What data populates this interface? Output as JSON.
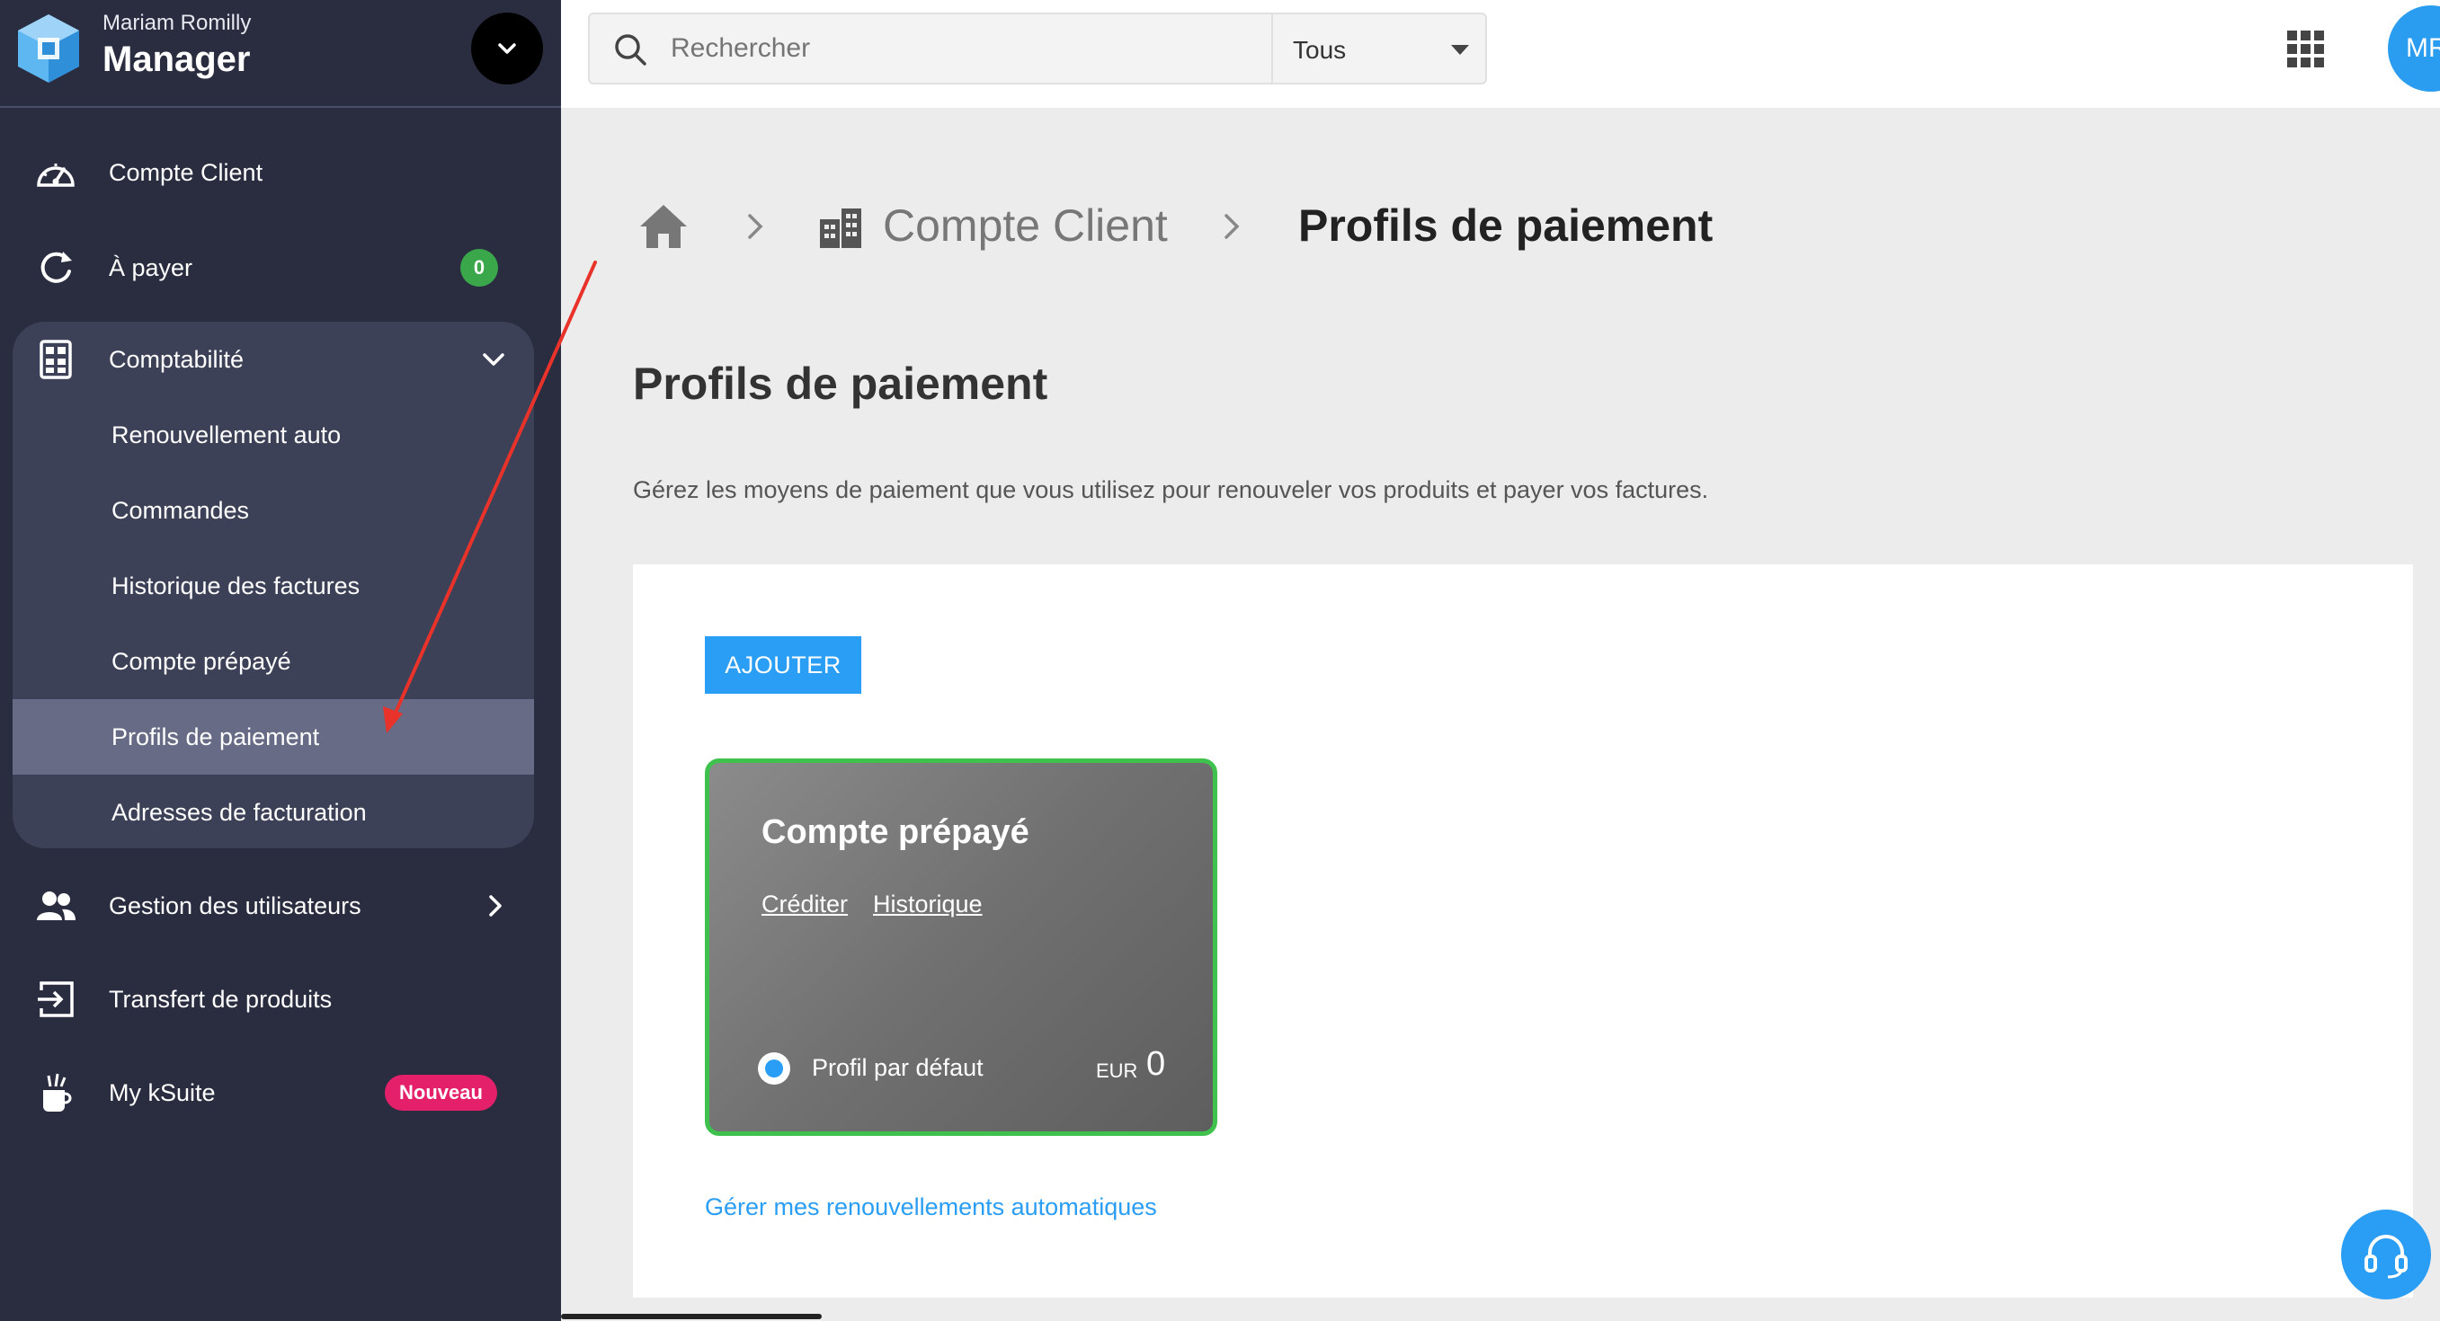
{
  "sidebar": {
    "user_name": "Mariam Romilly",
    "app_name": "Manager",
    "items": [
      {
        "label": "Compte Client",
        "icon": "dashboard-gauge-icon"
      },
      {
        "label": "À payer",
        "icon": "refresh-icon",
        "badge": "0"
      },
      {
        "label": "Comptabilité",
        "icon": "calculator-icon",
        "expanded": true,
        "children": [
          {
            "label": "Renouvellement auto"
          },
          {
            "label": "Commandes"
          },
          {
            "label": "Historique des factures"
          },
          {
            "label": "Compte prépayé"
          },
          {
            "label": "Profils de paiement",
            "active": true
          },
          {
            "label": "Adresses de facturation"
          }
        ]
      },
      {
        "label": "Gestion des utilisateurs",
        "icon": "users-icon"
      },
      {
        "label": "Transfert de produits",
        "icon": "transfer-icon"
      },
      {
        "label": "My kSuite",
        "icon": "ksuite-icon",
        "badge": "Nouveau"
      }
    ]
  },
  "topbar": {
    "search_placeholder": "Rechercher",
    "scope_value": "Tous",
    "avatar_initials": "MR"
  },
  "breadcrumb": {
    "parent": "Compte Client",
    "current": "Profils de paiement"
  },
  "main": {
    "title": "Profils de paiement",
    "description": "Gérez les moyens de paiement que vous utilisez pour renouveler vos produits et payer vos factures.",
    "add_button": "AJOUTER",
    "profile_card": {
      "title": "Compte prépayé",
      "link_credit": "Créditer",
      "link_history": "Historique",
      "default_label": "Profil par défaut",
      "currency": "EUR",
      "amount": "0"
    },
    "renew_link": "Gérer mes renouvellements automatiques"
  },
  "colors": {
    "sidebar_bg": "#2a2d40",
    "accent_blue": "#2a9df4",
    "active_green": "#3ec24d",
    "badge_pink": "#e5206b",
    "annotation_red": "#e8322a"
  }
}
